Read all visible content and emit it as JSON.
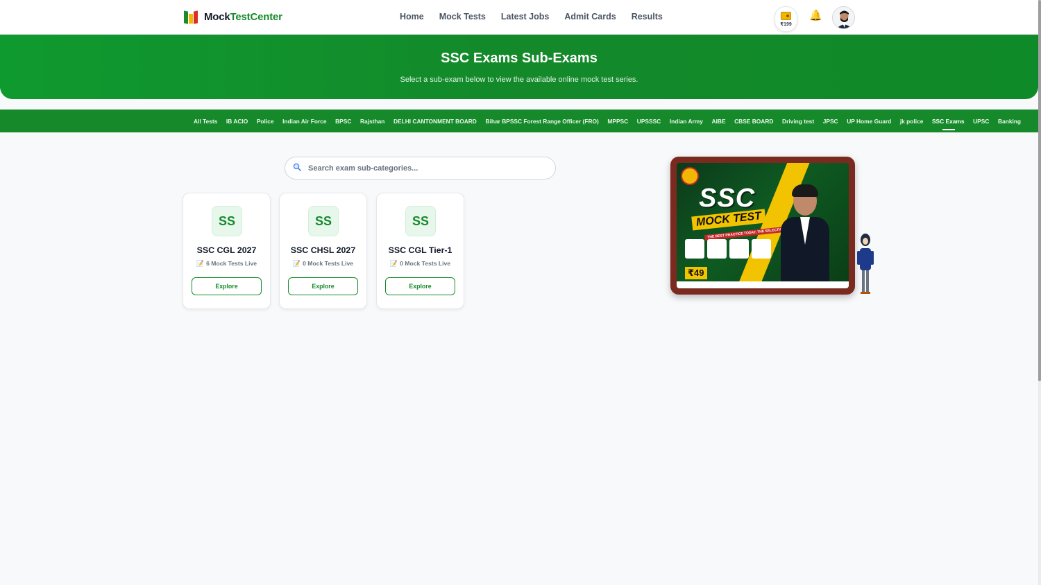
{
  "brand": {
    "name_part1": "Mock",
    "name_part2": "TestCenter"
  },
  "nav": [
    {
      "label": "Home"
    },
    {
      "label": "Mock Tests"
    },
    {
      "label": "Latest Jobs"
    },
    {
      "label": "Admit Cards"
    },
    {
      "label": "Results"
    }
  ],
  "wallet": {
    "amount": "₹199"
  },
  "hero": {
    "title": "SSC Exams Sub-Exams",
    "subtitle": "Select a sub-exam below to view the available online mock test series."
  },
  "categories": [
    "All Tests",
    "IB ACIO",
    "Police",
    "Indian Air Force",
    "BPSC",
    "Rajsthan",
    "DELHI CANTONMENT BOARD",
    "Bihar BPSSC Forest Range Officer (FRO)",
    "MPPSC",
    "UPSSSC",
    "Indian Army",
    "AIBE",
    "CBSE BOARD",
    "Driving test",
    "JPSC",
    "UP Home Guard",
    "jk police",
    "SSC Exams",
    "UPSC",
    "Banking"
  ],
  "active_category": "SSC Exams",
  "search": {
    "placeholder": "Search exam sub-categories..."
  },
  "cards": [
    {
      "badge": "SS",
      "title": "SSC CGL 2027",
      "count": "6 Mock Tests Live",
      "button": "Explore"
    },
    {
      "badge": "SS",
      "title": "SSC CHSL 2027",
      "count": "0 Mock Tests Live",
      "button": "Explore"
    },
    {
      "badge": "SS",
      "title": "SSC CGL Tier-1",
      "count": "0 Mock Tests Live",
      "button": "Explore"
    }
  ],
  "promo": {
    "headline": "SSC",
    "subheadline": "MOCK TEST",
    "tagline": "THE BEST PRACTICE TODAY, THE SELECTION TOMORROW!",
    "price": "₹49"
  },
  "colors": {
    "primary": "#168a2a",
    "hero": "#13892a",
    "accent_yellow": "#f2c300"
  }
}
